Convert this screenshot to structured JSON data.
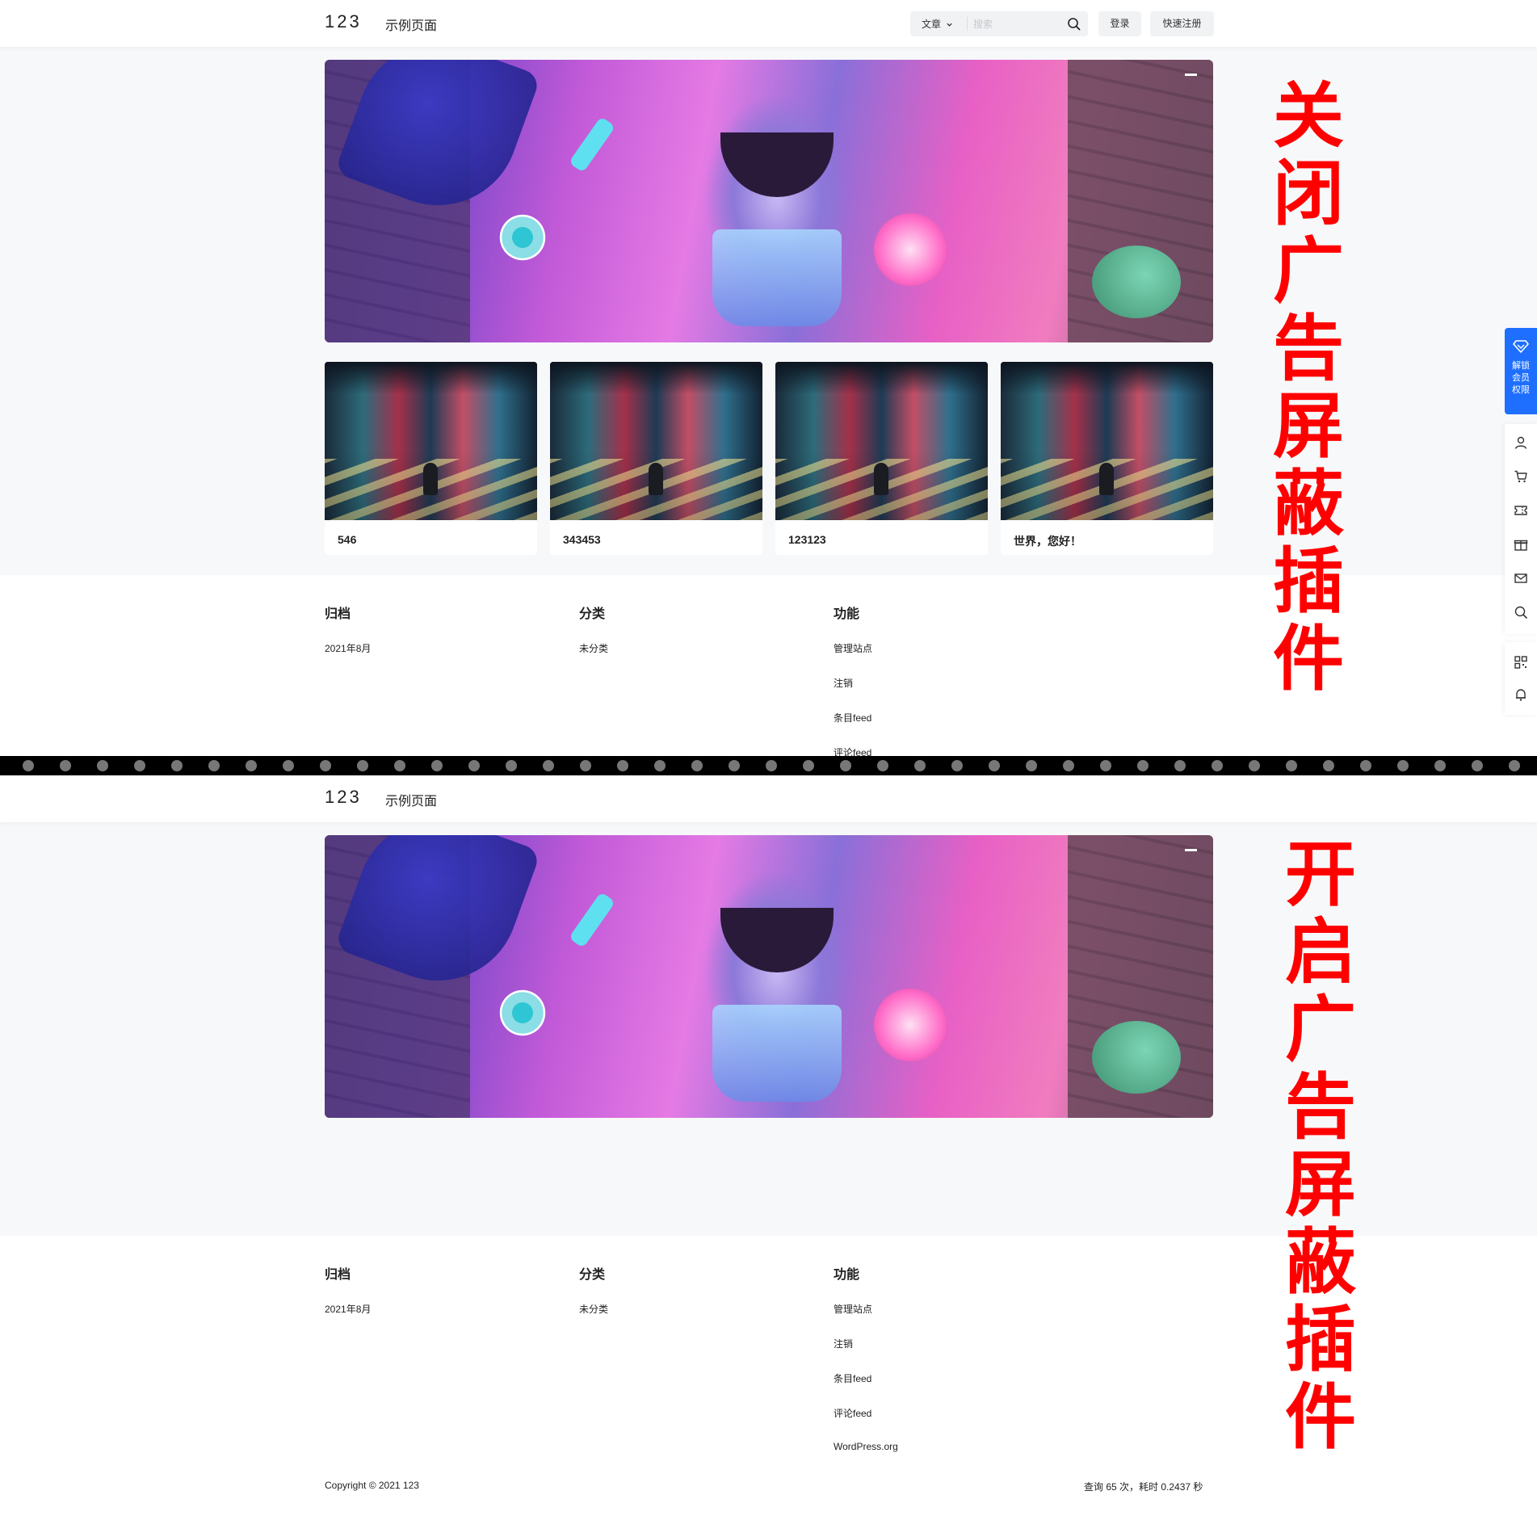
{
  "site": {
    "logo": "123",
    "nav_page": "示例页面",
    "article_dropdown": "文章",
    "search_placeholder": "搜索",
    "login": "登录",
    "register": "快速注册"
  },
  "posts": [
    {
      "title": "546"
    },
    {
      "title": "343453"
    },
    {
      "title": "123123"
    },
    {
      "title": "世界，您好！"
    }
  ],
  "footer": {
    "archive_heading": "归档",
    "archive_items": [
      "2021年8月"
    ],
    "category_heading": "分类",
    "category_items": [
      "未分类"
    ],
    "function_heading": "功能",
    "function_items": [
      "管理站点",
      "注销",
      "条目feed",
      "评论feed",
      "WordPress.org"
    ],
    "copyright": "Copyright © 2021 123",
    "stats": "查询 65 次，耗时 0.2437 秒"
  },
  "sidebar": {
    "vip_label": "解锁\n会员\n权限",
    "icons": [
      "user-icon",
      "cart-icon",
      "coupon-icon",
      "gift-icon",
      "mail-icon",
      "search-icon",
      "qrcode-icon",
      "bell-icon"
    ]
  },
  "annotations": {
    "top": "关闭广告屏蔽插件",
    "bottom": "开启广告屏蔽插件",
    "color": "#ff0000"
  },
  "theme": {
    "accent": "#1e6fff",
    "background": "#f7f8fa"
  }
}
